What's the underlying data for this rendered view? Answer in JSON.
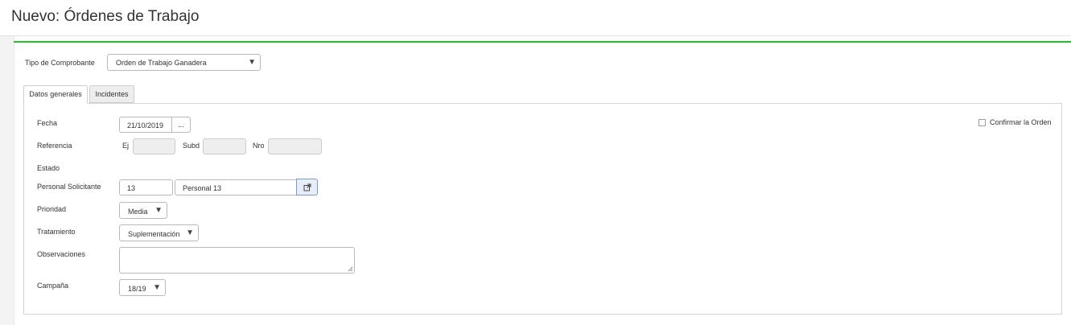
{
  "header": {
    "title": "Nuevo: Órdenes de Trabajo"
  },
  "comprobante": {
    "label": "Tipo de Comprobante",
    "value": "Orden de Trabajo Ganadera"
  },
  "tabs": [
    {
      "label": "Datos generales",
      "active": true
    },
    {
      "label": "Incidentes",
      "active": false
    }
  ],
  "form": {
    "fecha": {
      "label": "Fecha",
      "value": "21/10/2019",
      "picker_label": "..."
    },
    "referencia": {
      "label": "Referencia",
      "ej_label": "Ej",
      "ej_value": "",
      "subd_label": "Subd",
      "subd_value": "",
      "nro_label": "Nro",
      "nro_value": ""
    },
    "estado": {
      "label": "Estado",
      "value": ""
    },
    "personal": {
      "label": "Personal Solicitante",
      "code": "13",
      "name": "Personal 13",
      "open_icon": "external-link-icon"
    },
    "prioridad": {
      "label": "Prioridad",
      "value": "Media"
    },
    "tratamiento": {
      "label": "Tratamiento",
      "value": "Suplementación"
    },
    "observaciones": {
      "label": "Observaciones",
      "value": ""
    },
    "campana": {
      "label": "Campaña",
      "value": "18/19"
    },
    "confirmar": {
      "label": "Confirmar la Orden",
      "checked": false
    }
  },
  "colors": {
    "accent": "#22c424"
  }
}
